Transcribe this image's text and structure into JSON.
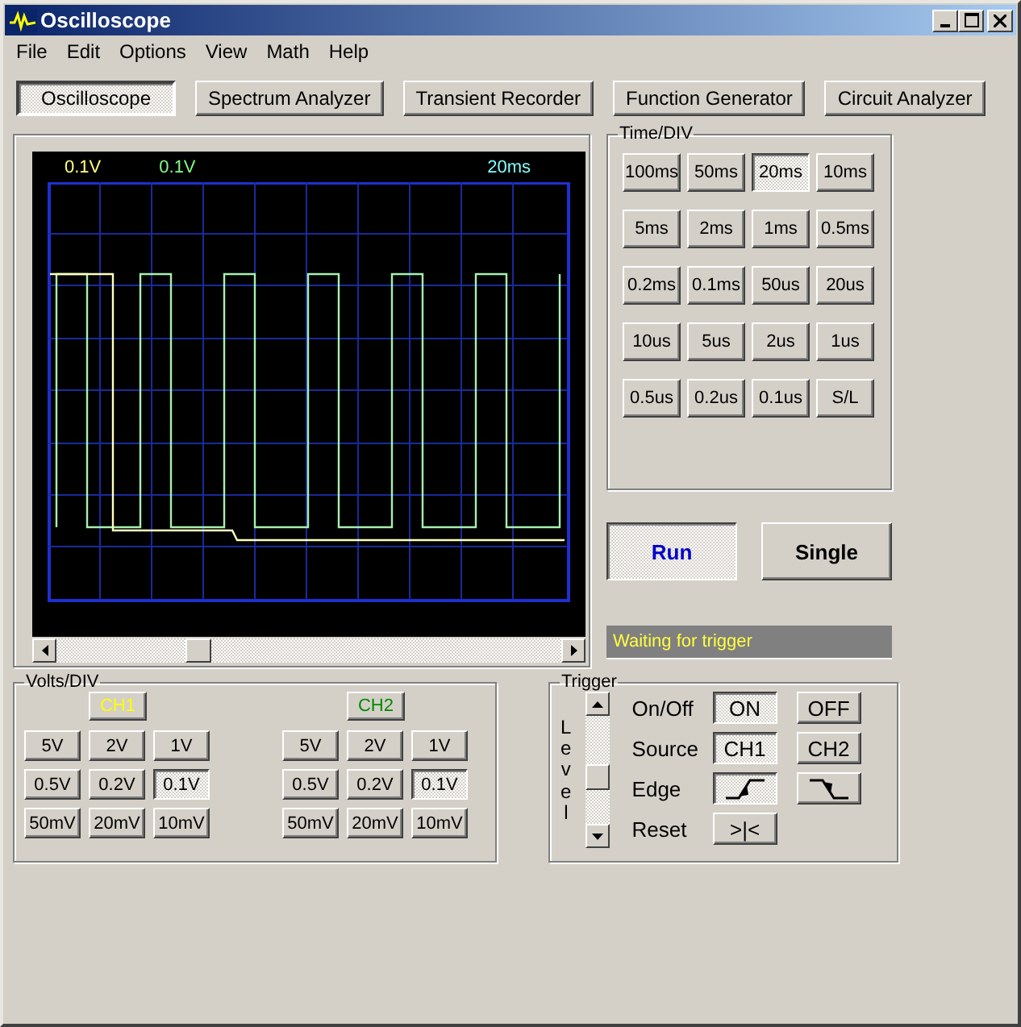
{
  "window": {
    "title": "Oscilloscope"
  },
  "menu": [
    "File",
    "Edit",
    "Options",
    "View",
    "Math",
    "Help"
  ],
  "modes": [
    {
      "label": "Oscilloscope",
      "selected": true
    },
    {
      "label": "Spectrum Analyzer",
      "selected": false
    },
    {
      "label": "Transient Recorder",
      "selected": false
    },
    {
      "label": "Function Generator",
      "selected": false
    },
    {
      "label": "Circuit Analyzer",
      "selected": false
    }
  ],
  "scope": {
    "ch1_scale": "0.1V",
    "ch2_scale": "0.1V",
    "time_scale": "20ms"
  },
  "time_div": {
    "title": "Time/DIV",
    "buttons": [
      {
        "label": "100ms",
        "selected": false
      },
      {
        "label": "50ms",
        "selected": false
      },
      {
        "label": "20ms",
        "selected": true
      },
      {
        "label": "10ms",
        "selected": false
      },
      {
        "label": "5ms",
        "selected": false
      },
      {
        "label": "2ms",
        "selected": false
      },
      {
        "label": "1ms",
        "selected": false
      },
      {
        "label": "0.5ms",
        "selected": false
      },
      {
        "label": "0.2ms",
        "selected": false
      },
      {
        "label": "0.1ms",
        "selected": false
      },
      {
        "label": "50us",
        "selected": false
      },
      {
        "label": "20us",
        "selected": false
      },
      {
        "label": "10us",
        "selected": false
      },
      {
        "label": "5us",
        "selected": false
      },
      {
        "label": "2us",
        "selected": false
      },
      {
        "label": "1us",
        "selected": false
      },
      {
        "label": "0.5us",
        "selected": false
      },
      {
        "label": "0.2us",
        "selected": false
      },
      {
        "label": "0.1us",
        "selected": false
      },
      {
        "label": "S/L",
        "selected": false
      }
    ]
  },
  "run_controls": [
    {
      "label": "Run",
      "selected": true
    },
    {
      "label": "Single",
      "selected": false
    }
  ],
  "status": "Waiting for trigger",
  "volts_div": {
    "title": "Volts/DIV",
    "channels": [
      {
        "label": "CH1",
        "color": "#ffff00",
        "buttons": [
          {
            "label": "5V",
            "selected": false
          },
          {
            "label": "2V",
            "selected": false
          },
          {
            "label": "1V",
            "selected": false
          },
          {
            "label": "0.5V",
            "selected": false
          },
          {
            "label": "0.2V",
            "selected": false
          },
          {
            "label": "0.1V",
            "selected": true
          },
          {
            "label": "50mV",
            "selected": false
          },
          {
            "label": "20mV",
            "selected": false
          },
          {
            "label": "10mV",
            "selected": false
          }
        ]
      },
      {
        "label": "CH2",
        "color": "#008a00",
        "buttons": [
          {
            "label": "5V",
            "selected": false
          },
          {
            "label": "2V",
            "selected": false
          },
          {
            "label": "1V",
            "selected": false
          },
          {
            "label": "0.5V",
            "selected": false
          },
          {
            "label": "0.2V",
            "selected": false
          },
          {
            "label": "0.1V",
            "selected": true
          },
          {
            "label": "50mV",
            "selected": false
          },
          {
            "label": "20mV",
            "selected": false
          },
          {
            "label": "10mV",
            "selected": false
          }
        ]
      }
    ]
  },
  "trigger": {
    "title": "Trigger",
    "level_label": "Level",
    "level": 0.45,
    "rows": [
      {
        "label": "On/Off",
        "options": [
          {
            "kind": "text",
            "label": "ON",
            "selected": true
          },
          {
            "kind": "text",
            "label": "OFF",
            "selected": false
          }
        ]
      },
      {
        "label": "Source",
        "options": [
          {
            "kind": "text",
            "label": "CH1",
            "selected": true
          },
          {
            "kind": "text",
            "label": "CH2",
            "selected": false
          }
        ]
      },
      {
        "label": "Edge",
        "options": [
          {
            "kind": "rising",
            "selected": true
          },
          {
            "kind": "falling",
            "selected": false
          }
        ]
      },
      {
        "label": "Reset",
        "options": [
          {
            "kind": "text",
            "label": ">|<"
          }
        ]
      }
    ]
  }
}
